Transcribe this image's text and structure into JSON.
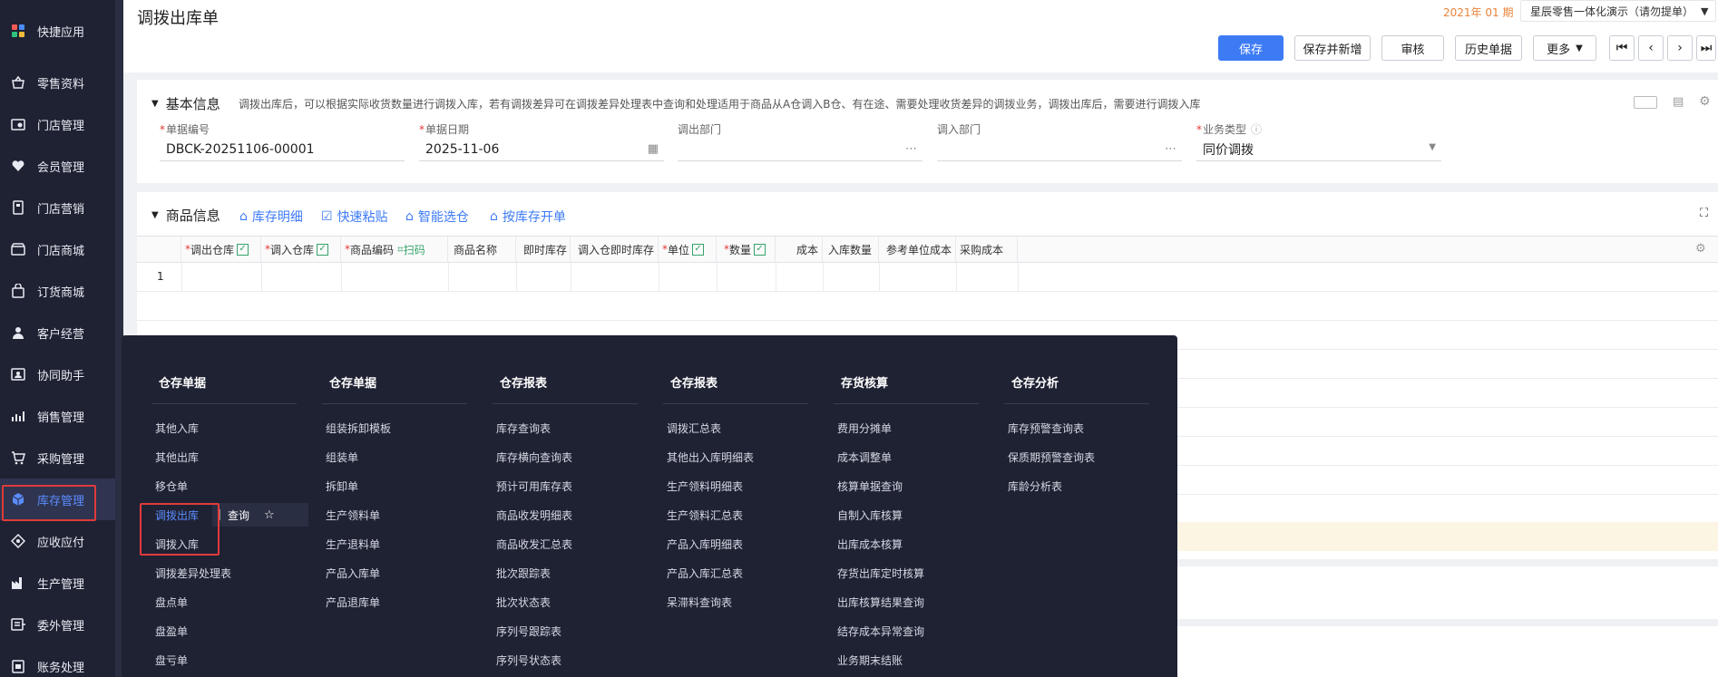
{
  "sidebar": {
    "items": [
      {
        "label": "快捷应用",
        "icon": "apps-icon"
      },
      {
        "label": "零售资料",
        "icon": "store-basket-icon"
      },
      {
        "label": "门店管理",
        "icon": "shop-settings-icon"
      },
      {
        "label": "会员管理",
        "icon": "heart-member-icon"
      },
      {
        "label": "门店营销",
        "icon": "marketing-tag-icon"
      },
      {
        "label": "门店商城",
        "icon": "mall-icon"
      },
      {
        "label": "订货商城",
        "icon": "order-bag-icon"
      },
      {
        "label": "客户经营",
        "icon": "customer-icon"
      },
      {
        "label": "协同助手",
        "icon": "assistant-icon"
      },
      {
        "label": "销售管理",
        "icon": "sales-chart-icon"
      },
      {
        "label": "采购管理",
        "icon": "cart-icon"
      },
      {
        "label": "库存管理",
        "icon": "cube-icon"
      },
      {
        "label": "应收应付",
        "icon": "finance-icon"
      },
      {
        "label": "生产管理",
        "icon": "factory-icon"
      },
      {
        "label": "委外管理",
        "icon": "outsource-icon"
      },
      {
        "label": "账务处理",
        "icon": "ledger-icon"
      }
    ],
    "active_index": 11
  },
  "header": {
    "title": "调拨出库单",
    "period": "2021年 01 期",
    "company": "星辰零售一体化演示（请勿提单）",
    "buttons": {
      "save": "保存",
      "save_new": "保存并新增",
      "audit": "审核",
      "history": "历史单据",
      "more": "更多"
    }
  },
  "basic": {
    "title": "基本信息",
    "desc": "调拨出库后，可以根据实际收货数量进行调拨入库，若有调拨差异可在调拨差异处理表中查询和处理适用于商品从A仓调入B仓、有在途、需要处理收货差异的调拨业务，调拨出库后，需要进行调拨入库",
    "fields": {
      "doc_no": {
        "label": "单据编号",
        "value": "DBCK-20251106-00001"
      },
      "doc_date": {
        "label": "单据日期",
        "value": "2025-11-06"
      },
      "out_dept": {
        "label": "调出部门",
        "value": ""
      },
      "in_dept": {
        "label": "调入部门",
        "value": ""
      },
      "biz_type": {
        "label": "业务类型",
        "value": "同价调拨"
      }
    }
  },
  "goods": {
    "title": "商品信息",
    "tools": [
      "库存明细",
      "快速粘贴",
      "智能选仓",
      "按库存开单"
    ],
    "columns": {
      "out_wh": "调出仓库",
      "in_wh": "调入仓库",
      "code": "商品编码",
      "scan": "扫码",
      "name": "商品名称",
      "stock": "即时库存",
      "in_stock": "调入仓即时库存",
      "unit": "单位",
      "qty": "数量",
      "cost": "成本",
      "in_qty": "入库数量",
      "ref_cost": "参考单位成本",
      "purchase_cost": "采购成本"
    },
    "row_no": "1"
  },
  "flyout": {
    "columns": [
      {
        "title": "仓存单据",
        "items": [
          "其他入库",
          "其他出库",
          "移仓单",
          "调拨出库",
          "调拨入库",
          "调拨差异处理表",
          "盘点单",
          "盘盈单",
          "盘亏单"
        ]
      },
      {
        "title": "仓存单据",
        "items": [
          "组装拆卸模板",
          "组装单",
          "拆卸单",
          "生产领料单",
          "生产退料单",
          "产品入库单",
          "产品退库单"
        ]
      },
      {
        "title": "仓存报表",
        "items": [
          "库存查询表",
          "库存横向查询表",
          "预计可用库存表",
          "商品收发明细表",
          "商品收发汇总表",
          "批次跟踪表",
          "批次状态表",
          "序列号跟踪表",
          "序列号状态表"
        ]
      },
      {
        "title": "仓存报表",
        "items": [
          "调拨汇总表",
          "其他出入库明细表",
          "生产领料明细表",
          "生产领料汇总表",
          "产品入库明细表",
          "产品入库汇总表",
          "呆滞料查询表"
        ]
      },
      {
        "title": "存货核算",
        "items": [
          "费用分摊单",
          "成本调整单",
          "核算单据查询",
          "自制入库核算",
          "出库成本核算",
          "存货出库定时核算",
          "出库核算结果查询",
          "结存成本异常查询",
          "业务期末结账"
        ]
      },
      {
        "title": "仓存分析",
        "items": [
          "库存预警查询表",
          "保质期预警查询表",
          "库龄分析表"
        ]
      }
    ],
    "active": "调拨出库",
    "query": "查询"
  }
}
